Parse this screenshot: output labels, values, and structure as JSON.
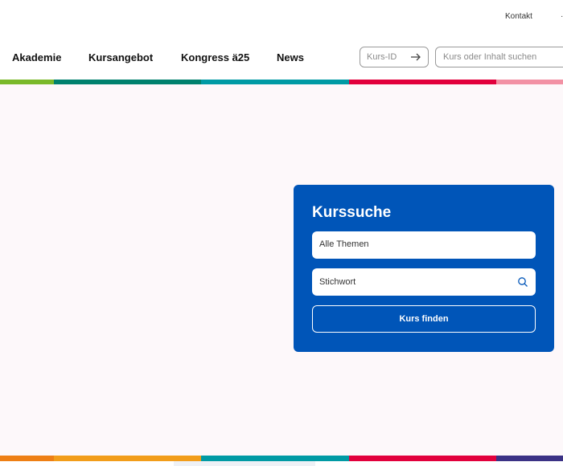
{
  "header": {
    "kontakt_label": "Kontakt"
  },
  "nav": {
    "items": [
      {
        "label": "Akademie"
      },
      {
        "label": "Kursangebot"
      },
      {
        "label": "Kongress ä25"
      },
      {
        "label": "News"
      }
    ]
  },
  "course_id": {
    "placeholder": "Kurs-ID",
    "submit_icon": "arrow-right-icon"
  },
  "site_search": {
    "placeholder": "Kurs oder Inhalt suchen"
  },
  "stripe_colors": {
    "top": [
      "#7ab929",
      "#00816d",
      "#009aa4",
      "#e2003c",
      "#f291a4"
    ],
    "bottom": [
      "#ee7f14",
      "#f29d1a",
      "#009aa4",
      "#e2003c",
      "#3b3285"
    ]
  },
  "course_search": {
    "title": "Kurssuche",
    "topics_value": "Alle Themen",
    "keyword_placeholder": "Stichwort",
    "search_icon": "magnifier-icon",
    "submit_label": "Kurs finden",
    "accent_color": "#0055b8"
  }
}
